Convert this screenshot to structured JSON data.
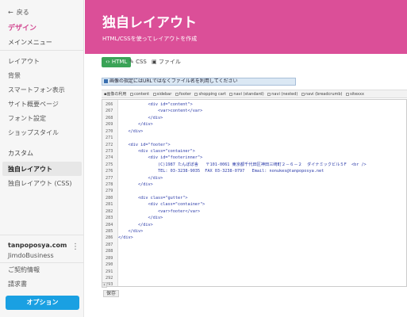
{
  "sidebar": {
    "back_label": "戻る",
    "section_title": "デザイン",
    "main_menu_title": "メインメニュー",
    "main_items": [
      {
        "label": "レイアウト"
      },
      {
        "label": "背景"
      },
      {
        "label": "スマートフォン表示"
      },
      {
        "label": "サイト概要ページ"
      },
      {
        "label": "フォント設定"
      },
      {
        "label": "ショップスタイル"
      }
    ],
    "custom_title": "カスタム",
    "custom_items": [
      {
        "label": "独自レイアウト"
      },
      {
        "label": "独自レイアウト (CSS)"
      }
    ],
    "site_name": "tanpoposya.com",
    "site_plan": "JimdoBusiness",
    "account_items": [
      {
        "label": "ご契約情報"
      },
      {
        "label": "請求書"
      }
    ],
    "option_button": "オプション"
  },
  "header": {
    "title": "独自レイアウト",
    "subtitle": "HTML/CSSを使ってレイアウトを作成"
  },
  "tabs": [
    {
      "label": "HTML"
    },
    {
      "label": "CSS"
    },
    {
      "label": "ファイル"
    }
  ],
  "info_bar": {
    "text": "画像の指定にはURLではなくファイル名を利用してください"
  },
  "toolbar": {
    "items": [
      {
        "label": "画像の利用"
      },
      {
        "label": "content"
      },
      {
        "label": "sidebar"
      },
      {
        "label": "footer"
      },
      {
        "label": "shopping cart"
      },
      {
        "label": "navi (standard)"
      },
      {
        "label": "navi (nested)"
      },
      {
        "label": "navi (breadcrumb)"
      },
      {
        "label": "sitexxx"
      }
    ]
  },
  "editor": {
    "lines": [
      {
        "num": "266",
        "code": "            <div id=\"content\">"
      },
      {
        "num": "267",
        "code": "                <var>content</var>"
      },
      {
        "num": "268",
        "code": "            </div>"
      },
      {
        "num": "269",
        "code": "        </div>"
      },
      {
        "num": "270",
        "code": "    </div>"
      },
      {
        "num": "271",
        "code": ""
      },
      {
        "num": "272",
        "code": "    <div id=\"footer\">"
      },
      {
        "num": "273",
        "code": "        <div class=\"container\">"
      },
      {
        "num": "274",
        "code": "            <div id=\"footerinner\">"
      },
      {
        "num": "275",
        "code": "                (C)1987 たんぽぽ舎   〒101-0061 東京都千代田区神田三崎町２－６－２  ダイナミックビル５F  <br />"
      },
      {
        "num": "276",
        "code": "                TEL: 03-3238-9035  FAX 03-3238-0797   Email: nonukes@tanpoposya.net"
      },
      {
        "num": "277",
        "code": "            </div>"
      },
      {
        "num": "278",
        "code": "        </div>"
      },
      {
        "num": "279",
        "code": ""
      },
      {
        "num": "280",
        "code": "        <div class=\"gutter\">"
      },
      {
        "num": "281",
        "code": "            <div class=\"container\">"
      },
      {
        "num": "282",
        "code": "                <var>footer</var>"
      },
      {
        "num": "283",
        "code": "            </div>"
      },
      {
        "num": "284",
        "code": "        </div>"
      },
      {
        "num": "285",
        "code": "    </div>"
      },
      {
        "num": "286",
        "code": "</div>"
      },
      {
        "num": "287",
        "code": ""
      },
      {
        "num": "288",
        "code": ""
      },
      {
        "num": "289",
        "code": ""
      },
      {
        "num": "290",
        "code": ""
      },
      {
        "num": "291",
        "code": ""
      },
      {
        "num": "292",
        "code": ""
      },
      {
        "num": "293",
        "code": ""
      },
      {
        "num": "294",
        "code": ""
      },
      {
        "num": "295",
        "code": ""
      },
      {
        "num": "296",
        "code": ""
      },
      {
        "num": "297",
        "code": ""
      },
      {
        "num": "298",
        "code": ""
      }
    ],
    "save_label": "保存"
  },
  "colors": {
    "brand": "#db4f98",
    "active_tab": "#3aa357",
    "option_button": "#1aa0e2"
  }
}
